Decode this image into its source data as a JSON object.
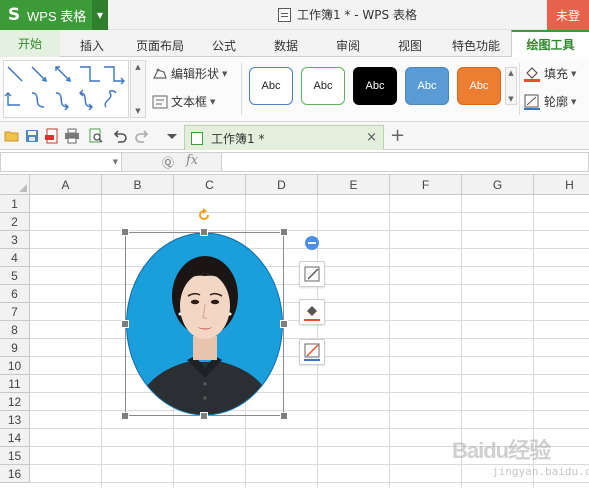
{
  "app": {
    "name": "WPS 表格",
    "logo_glyph": "S",
    "dropdown_glyph": "▼",
    "accent": "#3d9a39"
  },
  "window": {
    "title": "工作簿1 * - WPS 表格",
    "login_label": "未登"
  },
  "menu": {
    "tabs": [
      {
        "label": "开始",
        "active": false
      },
      {
        "label": "插入",
        "active": false
      },
      {
        "label": "页面布局",
        "active": false
      },
      {
        "label": "公式",
        "active": false
      },
      {
        "label": "数据",
        "active": false
      },
      {
        "label": "审阅",
        "active": false
      },
      {
        "label": "视图",
        "active": false
      },
      {
        "label": "特色功能",
        "active": false
      },
      {
        "label": "绘图工具",
        "active": true
      }
    ]
  },
  "ribbon": {
    "edit_shape_label": "编辑形状",
    "text_box_label": "文本框",
    "fill_label": "填充",
    "outline_label": "轮廓",
    "shape_styles": [
      {
        "label": "Abc",
        "bg": "#ffffff",
        "border": "#4a7fc1",
        "color": "#222222"
      },
      {
        "label": "Abc",
        "bg": "#ffffff",
        "border": "#5fb35a",
        "color": "#222222"
      },
      {
        "label": "Abc",
        "bg": "#000000",
        "border": "#000000",
        "color": "#ffffff"
      },
      {
        "label": "Abc",
        "bg": "#5b9bd5",
        "border": "#4a86c0",
        "color": "#ffffff"
      },
      {
        "label": "Abc",
        "bg": "#ed7d31",
        "border": "#d56b22",
        "color": "#ffffff"
      }
    ]
  },
  "doc_tabs": {
    "active_tab": "工作簿1 *",
    "close_glyph": "×",
    "new_tab_glyph": "+"
  },
  "formula_bar": {
    "name_box": "",
    "formula": "",
    "fx_label": "fx",
    "zoom_glyph": "Ⓠ"
  },
  "sheet": {
    "columns": [
      "A",
      "B",
      "C",
      "D",
      "E",
      "F",
      "G",
      "H"
    ],
    "rows": [
      "1",
      "2",
      "3",
      "4",
      "5",
      "6",
      "7",
      "8",
      "9",
      "10",
      "11",
      "12",
      "13",
      "14",
      "15",
      "16"
    ]
  },
  "picture": {
    "background_color": "#1a9fdc",
    "selected": true
  },
  "watermark": {
    "text": "Baidu经验",
    "sub": "jingyan.baidu.com"
  }
}
